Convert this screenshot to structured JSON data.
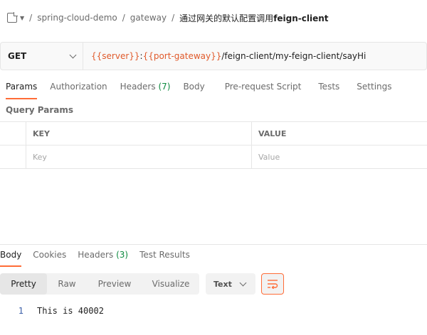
{
  "breadcrumb": {
    "items": [
      "spring-cloud-demo",
      "gateway"
    ],
    "current_prefix": "通过网关的默认配置调用",
    "current_bold": "feign-client",
    "separator": "/"
  },
  "request": {
    "method": "GET",
    "url_var1": "{{server}}",
    "url_colon": ":",
    "url_var2": "{{port-gateway}}",
    "url_path": "/feign-client/my-feign-client/sayHi"
  },
  "request_tabs": {
    "params": "Params",
    "authorization": "Authorization",
    "headers": "Headers",
    "headers_count": "(7)",
    "body": "Body",
    "prerequest": "Pre-request Script",
    "tests": "Tests",
    "settings": "Settings"
  },
  "query_params": {
    "label": "Query Params",
    "key_header": "KEY",
    "value_header": "VALUE",
    "key_placeholder": "Key",
    "value_placeholder": "Value"
  },
  "response_tabs": {
    "body": "Body",
    "cookies": "Cookies",
    "headers": "Headers",
    "headers_count": "(3)",
    "test_results": "Test Results"
  },
  "response_view": {
    "pretty": "Pretty",
    "raw": "Raw",
    "preview": "Preview",
    "visualize": "Visualize",
    "format": "Text"
  },
  "response_body": {
    "line_number": "1",
    "line_text": "This is 40002"
  },
  "colors": {
    "accent": "#ff6c37",
    "variable": "#e05a2b",
    "count": "#0d8a3f"
  }
}
